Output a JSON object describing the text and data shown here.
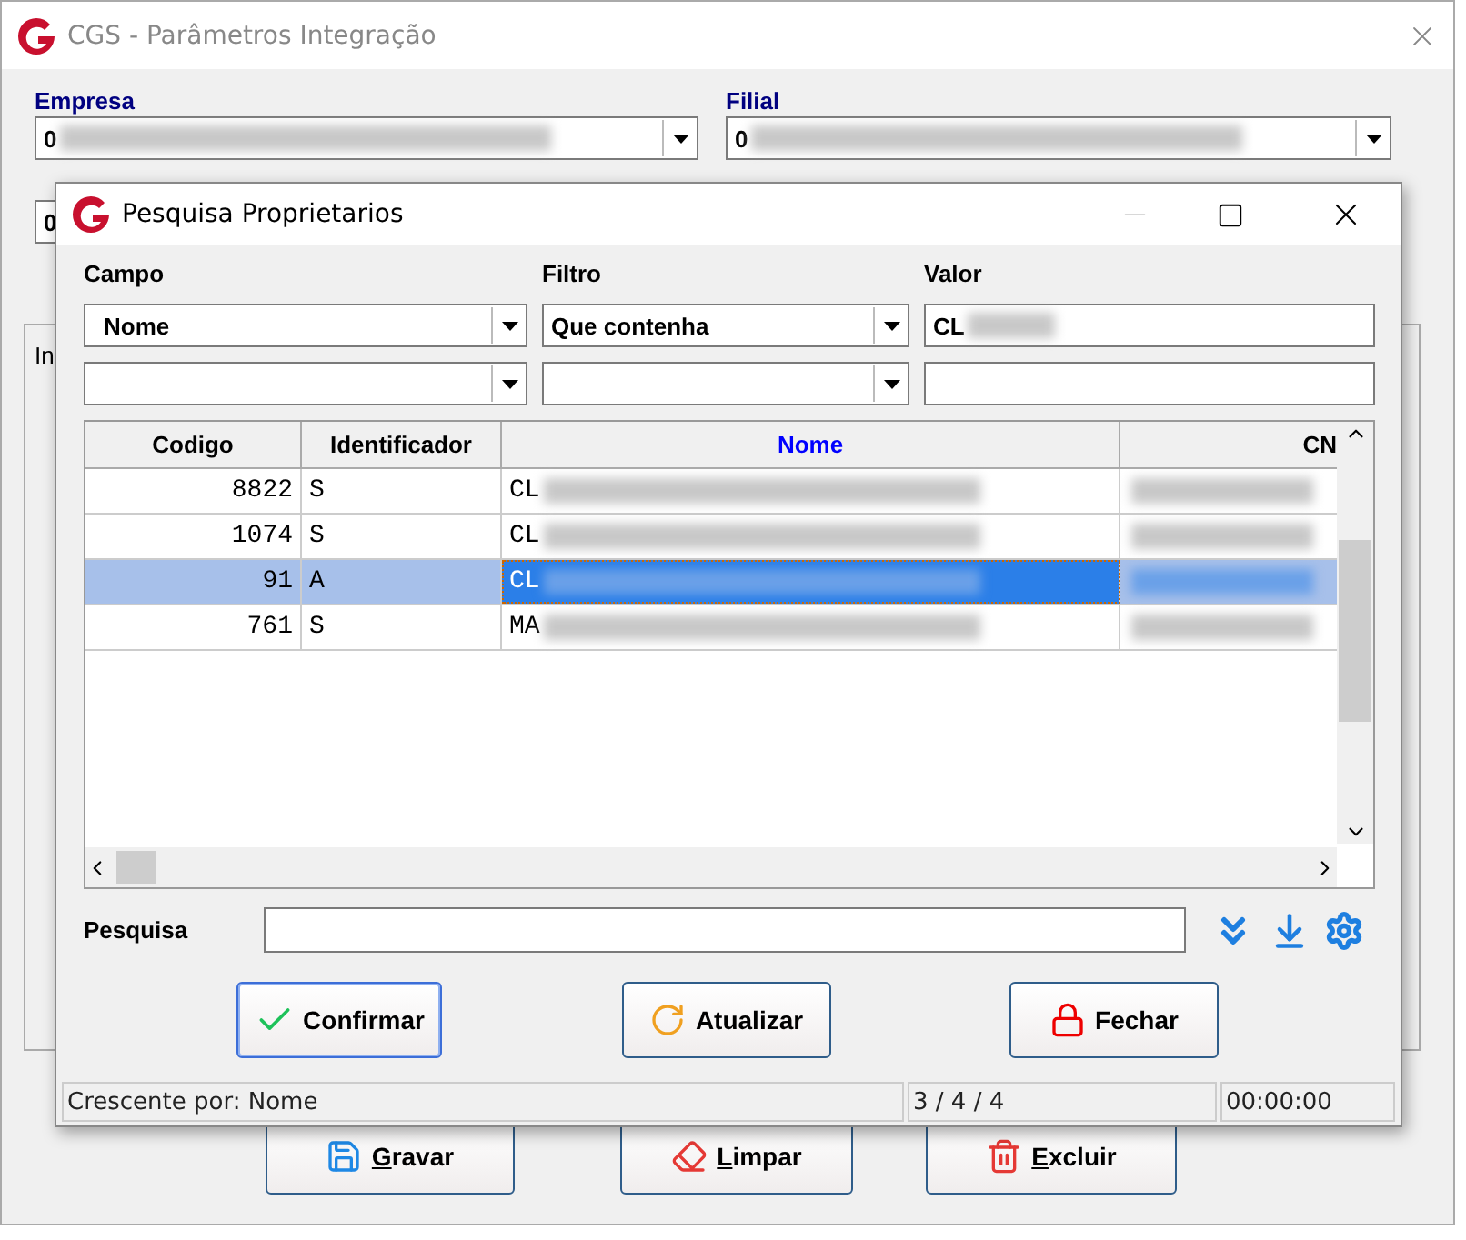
{
  "main_window": {
    "title": "CGS - Parâmetros Integração",
    "fields": [
      {
        "label": "Empresa",
        "value": "0",
        "blurred": true
      },
      {
        "label": "Filial",
        "value": "0",
        "blurred": true
      }
    ],
    "extra_combo": {
      "value": "0"
    },
    "tab": {
      "label": "In"
    },
    "buttons": [
      {
        "label": "Gravar",
        "kind": "save"
      },
      {
        "label": "Limpar",
        "kind": "clear"
      },
      {
        "label": "Excluir",
        "kind": "delete"
      }
    ]
  },
  "dialog": {
    "title": "Pesquisa Proprietarios",
    "filters": [
      {
        "label": "Campo",
        "value": "Nome"
      },
      {
        "label": "Filtro",
        "value": "Que contenha"
      },
      {
        "label": "Valor",
        "value": "CL",
        "blurred": true
      }
    ],
    "columns": [
      {
        "label": "Codigo",
        "sorted": false
      },
      {
        "label": "Identificador",
        "sorted": false
      },
      {
        "label": "Nome",
        "sorted": true
      },
      {
        "label": "CN",
        "sorted": false
      }
    ],
    "rows": [
      {
        "codigo": "8822",
        "identificador": "S",
        "nome": "CL",
        "selected": false
      },
      {
        "codigo": "1074",
        "identificador": "S",
        "nome": "CL",
        "selected": false
      },
      {
        "codigo": "91",
        "identificador": "A",
        "nome": "CL",
        "selected": true
      },
      {
        "codigo": "761",
        "identificador": "S",
        "nome": "MA",
        "selected": false
      }
    ],
    "search": {
      "label": "Pesquisa"
    },
    "buttons": [
      {
        "label": "Confirmar",
        "kind": "confirm"
      },
      {
        "label": "Atualizar",
        "kind": "refresh"
      },
      {
        "label": "Fechar",
        "kind": "close"
      }
    ],
    "status_bar": [
      "Crescente por:  Nome",
      "3 / 4 / 4",
      "00:00:00"
    ]
  }
}
